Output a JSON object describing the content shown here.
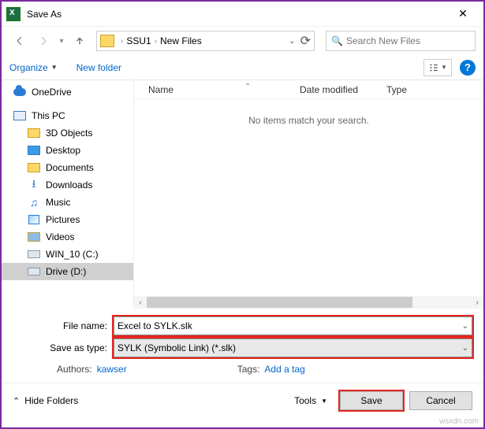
{
  "title": "Save As",
  "breadcrumb": {
    "seg1": "SSU1",
    "seg2": "New Files"
  },
  "search": {
    "placeholder": "Search New Files"
  },
  "toolbar": {
    "organize": "Organize",
    "newfolder": "New folder"
  },
  "columns": {
    "name": "Name",
    "date": "Date modified",
    "type": "Type"
  },
  "empty": "No items match your search.",
  "tree": {
    "onedrive": "OneDrive",
    "thispc": "This PC",
    "obj3d": "3D Objects",
    "desktop": "Desktop",
    "documents": "Documents",
    "downloads": "Downloads",
    "music": "Music",
    "pictures": "Pictures",
    "videos": "Videos",
    "win10": "WIN_10 (C:)",
    "drived": "Drive (D:)"
  },
  "form": {
    "filename_label": "File name:",
    "filename_value": "Excel to SYLK.slk",
    "savetype_label": "Save as type:",
    "savetype_value": "SYLK (Symbolic Link) (*.slk)",
    "authors_label": "Authors:",
    "authors_value": "kawser",
    "tags_label": "Tags:",
    "tags_value": "Add a tag"
  },
  "footer": {
    "hidefolders": "Hide Folders",
    "tools": "Tools",
    "save": "Save",
    "cancel": "Cancel"
  },
  "watermark": "wsxdn.com"
}
